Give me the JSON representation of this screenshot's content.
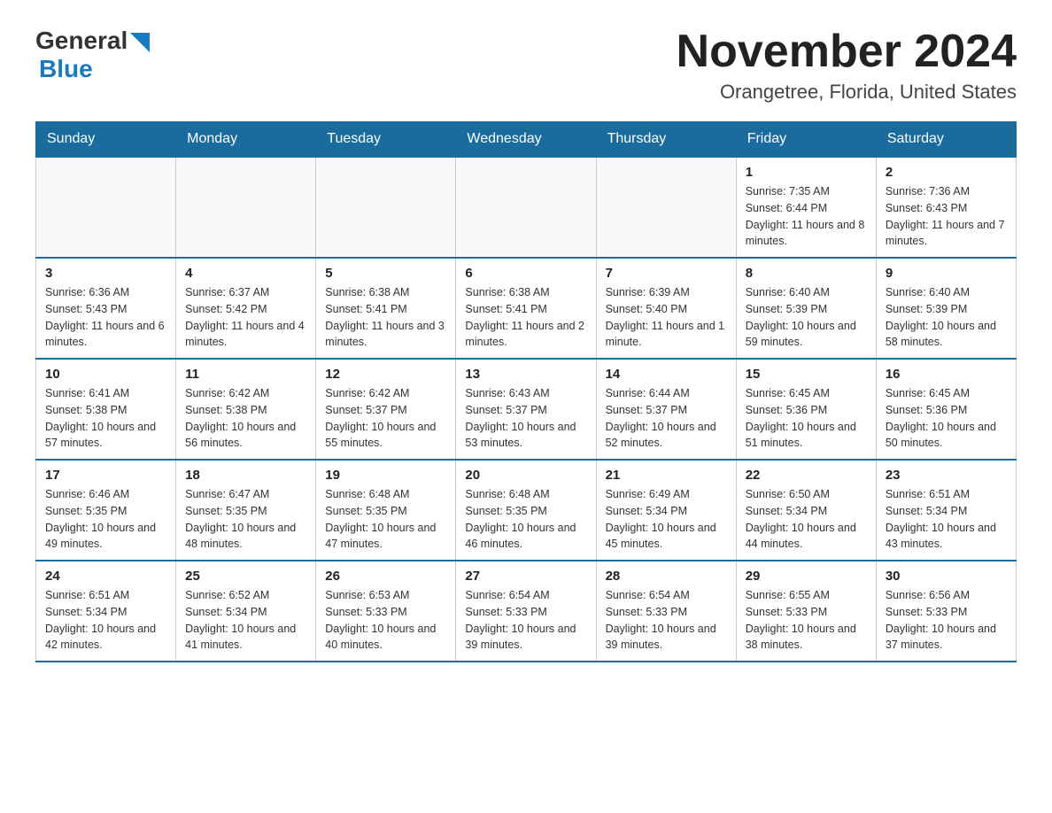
{
  "header": {
    "logo": {
      "general": "General",
      "blue": "Blue",
      "triangle": "▶"
    },
    "title": "November 2024",
    "subtitle": "Orangetree, Florida, United States"
  },
  "calendar": {
    "days_of_week": [
      "Sunday",
      "Monday",
      "Tuesday",
      "Wednesday",
      "Thursday",
      "Friday",
      "Saturday"
    ],
    "weeks": [
      [
        {
          "day": "",
          "info": ""
        },
        {
          "day": "",
          "info": ""
        },
        {
          "day": "",
          "info": ""
        },
        {
          "day": "",
          "info": ""
        },
        {
          "day": "",
          "info": ""
        },
        {
          "day": "1",
          "info": "Sunrise: 7:35 AM\nSunset: 6:44 PM\nDaylight: 11 hours and 8 minutes."
        },
        {
          "day": "2",
          "info": "Sunrise: 7:36 AM\nSunset: 6:43 PM\nDaylight: 11 hours and 7 minutes."
        }
      ],
      [
        {
          "day": "3",
          "info": "Sunrise: 6:36 AM\nSunset: 5:43 PM\nDaylight: 11 hours and 6 minutes."
        },
        {
          "day": "4",
          "info": "Sunrise: 6:37 AM\nSunset: 5:42 PM\nDaylight: 11 hours and 4 minutes."
        },
        {
          "day": "5",
          "info": "Sunrise: 6:38 AM\nSunset: 5:41 PM\nDaylight: 11 hours and 3 minutes."
        },
        {
          "day": "6",
          "info": "Sunrise: 6:38 AM\nSunset: 5:41 PM\nDaylight: 11 hours and 2 minutes."
        },
        {
          "day": "7",
          "info": "Sunrise: 6:39 AM\nSunset: 5:40 PM\nDaylight: 11 hours and 1 minute."
        },
        {
          "day": "8",
          "info": "Sunrise: 6:40 AM\nSunset: 5:39 PM\nDaylight: 10 hours and 59 minutes."
        },
        {
          "day": "9",
          "info": "Sunrise: 6:40 AM\nSunset: 5:39 PM\nDaylight: 10 hours and 58 minutes."
        }
      ],
      [
        {
          "day": "10",
          "info": "Sunrise: 6:41 AM\nSunset: 5:38 PM\nDaylight: 10 hours and 57 minutes."
        },
        {
          "day": "11",
          "info": "Sunrise: 6:42 AM\nSunset: 5:38 PM\nDaylight: 10 hours and 56 minutes."
        },
        {
          "day": "12",
          "info": "Sunrise: 6:42 AM\nSunset: 5:37 PM\nDaylight: 10 hours and 55 minutes."
        },
        {
          "day": "13",
          "info": "Sunrise: 6:43 AM\nSunset: 5:37 PM\nDaylight: 10 hours and 53 minutes."
        },
        {
          "day": "14",
          "info": "Sunrise: 6:44 AM\nSunset: 5:37 PM\nDaylight: 10 hours and 52 minutes."
        },
        {
          "day": "15",
          "info": "Sunrise: 6:45 AM\nSunset: 5:36 PM\nDaylight: 10 hours and 51 minutes."
        },
        {
          "day": "16",
          "info": "Sunrise: 6:45 AM\nSunset: 5:36 PM\nDaylight: 10 hours and 50 minutes."
        }
      ],
      [
        {
          "day": "17",
          "info": "Sunrise: 6:46 AM\nSunset: 5:35 PM\nDaylight: 10 hours and 49 minutes."
        },
        {
          "day": "18",
          "info": "Sunrise: 6:47 AM\nSunset: 5:35 PM\nDaylight: 10 hours and 48 minutes."
        },
        {
          "day": "19",
          "info": "Sunrise: 6:48 AM\nSunset: 5:35 PM\nDaylight: 10 hours and 47 minutes."
        },
        {
          "day": "20",
          "info": "Sunrise: 6:48 AM\nSunset: 5:35 PM\nDaylight: 10 hours and 46 minutes."
        },
        {
          "day": "21",
          "info": "Sunrise: 6:49 AM\nSunset: 5:34 PM\nDaylight: 10 hours and 45 minutes."
        },
        {
          "day": "22",
          "info": "Sunrise: 6:50 AM\nSunset: 5:34 PM\nDaylight: 10 hours and 44 minutes."
        },
        {
          "day": "23",
          "info": "Sunrise: 6:51 AM\nSunset: 5:34 PM\nDaylight: 10 hours and 43 minutes."
        }
      ],
      [
        {
          "day": "24",
          "info": "Sunrise: 6:51 AM\nSunset: 5:34 PM\nDaylight: 10 hours and 42 minutes."
        },
        {
          "day": "25",
          "info": "Sunrise: 6:52 AM\nSunset: 5:34 PM\nDaylight: 10 hours and 41 minutes."
        },
        {
          "day": "26",
          "info": "Sunrise: 6:53 AM\nSunset: 5:33 PM\nDaylight: 10 hours and 40 minutes."
        },
        {
          "day": "27",
          "info": "Sunrise: 6:54 AM\nSunset: 5:33 PM\nDaylight: 10 hours and 39 minutes."
        },
        {
          "day": "28",
          "info": "Sunrise: 6:54 AM\nSunset: 5:33 PM\nDaylight: 10 hours and 39 minutes."
        },
        {
          "day": "29",
          "info": "Sunrise: 6:55 AM\nSunset: 5:33 PM\nDaylight: 10 hours and 38 minutes."
        },
        {
          "day": "30",
          "info": "Sunrise: 6:56 AM\nSunset: 5:33 PM\nDaylight: 10 hours and 37 minutes."
        }
      ]
    ]
  }
}
